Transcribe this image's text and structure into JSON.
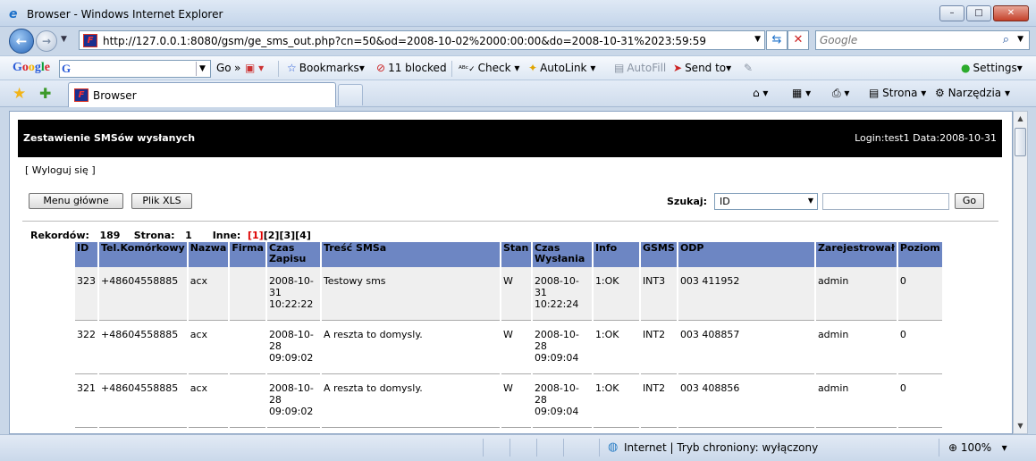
{
  "window": {
    "title": "Browser - Windows Internet Explorer",
    "min": "–",
    "max": "□",
    "close": "✕"
  },
  "address": {
    "url": "http://127.0.0.1:8080/gsm/ge_sms_out.php?cn=50&od=2008-10-02%2000:00:00&do=2008-10-31%2023:59:59",
    "search_placeholder": "Google"
  },
  "gtoolbar": {
    "go": "Go",
    "bookmarks": "Bookmarks",
    "blocked": "11 blocked",
    "check": "Check",
    "autolink": "AutoLink",
    "autofill": "AutoFill",
    "sendto": "Send to",
    "settings": "Settings"
  },
  "tabs": [
    {
      "label": "Browser"
    }
  ],
  "commands": {
    "strona": "Strona",
    "narzedzia": "Narzędzia"
  },
  "page": {
    "header_title": "Zestawienie SMSów wysłanych",
    "header_right": "Login:test1 Data:2008-10-31",
    "logout": "[ Wyloguj się ]",
    "menu_button": "Menu główne",
    "xls_button": "Plik XLS",
    "search_label": "Szukaj:",
    "search_field_value": "ID",
    "go_button": "Go",
    "stats": {
      "records_label": "Rekordów:",
      "records_value": "189",
      "page_label": "Strona:",
      "page_value": "1",
      "other_label": "Inne:",
      "pages": [
        "[1]",
        "[2]",
        "[3]",
        "[4]"
      ]
    },
    "columns": [
      "ID",
      "Tel.Komórkowy",
      "Nazwa",
      "Firma",
      "Czas Zapisu",
      "Treść SMSa",
      "Stan",
      "Czas Wysłania",
      "Info",
      "GSMS",
      "ODP",
      "Zarejestrował",
      "Poziom"
    ],
    "rows": [
      {
        "id": "323",
        "tel": "+48604558885",
        "nazwa": "acx",
        "firma": "",
        "czas_zapisu": [
          "2008-10-",
          "31",
          "10:22:22"
        ],
        "tresc": "Testowy sms",
        "stan": "W",
        "czas_wyslania": [
          "2008-10-",
          "31",
          "10:22:24"
        ],
        "info": "1:OK",
        "gsms": "INT3",
        "odp": "003 411952",
        "zarej": "admin",
        "poziom": "0"
      },
      {
        "id": "322",
        "tel": "+48604558885",
        "nazwa": "acx",
        "firma": "",
        "czas_zapisu": [
          "2008-10-",
          "28",
          "09:09:02"
        ],
        "tresc": "A reszta to domysly.",
        "stan": "W",
        "czas_wyslania": [
          "2008-10-",
          "28",
          "09:09:04"
        ],
        "info": "1:OK",
        "gsms": "INT2",
        "odp": "003 408857",
        "zarej": "admin",
        "poziom": "0"
      },
      {
        "id": "321",
        "tel": "+48604558885",
        "nazwa": "acx",
        "firma": "",
        "czas_zapisu": [
          "2008-10-",
          "28",
          "09:09:02"
        ],
        "tresc": "A reszta to domysly.",
        "stan": "W",
        "czas_wyslania": [
          "2008-10-",
          "28",
          "09:09:04"
        ],
        "info": "1:OK",
        "gsms": "INT2",
        "odp": "003 408856",
        "zarej": "admin",
        "poziom": "0"
      }
    ]
  },
  "status": {
    "zone": "Internet | Tryb chroniony: wyłączony",
    "zoom": "100%"
  }
}
